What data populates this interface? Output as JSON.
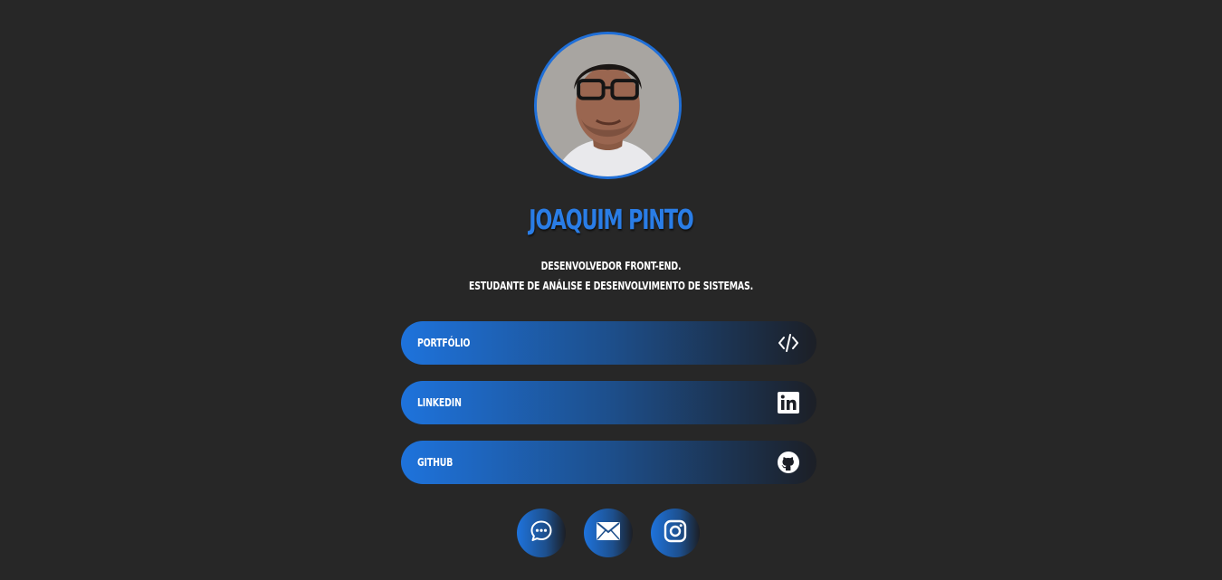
{
  "profile": {
    "name": "JOAQUIM PINTO",
    "bio_line1": "DESENVOLVEDOR FRONT-END.",
    "bio_line2": "ESTUDANTE DE ANÁLISE E DESENVOLVIMENTO DE SISTEMAS."
  },
  "links": [
    {
      "label": "PORTFÓLIO",
      "icon": "code-icon"
    },
    {
      "label": "LINKEDIN",
      "icon": "linkedin-icon"
    },
    {
      "label": "GITHUB",
      "icon": "github-icon"
    }
  ],
  "social": [
    {
      "icon": "whatsapp-chat-icon"
    },
    {
      "icon": "mail-icon"
    },
    {
      "icon": "instagram-icon"
    }
  ],
  "colors": {
    "background": "#272727",
    "accent": "#2a7de6",
    "button_gradient_start": "#1e73dc",
    "button_gradient_end": "#1c1f26",
    "text": "#ffffff"
  }
}
